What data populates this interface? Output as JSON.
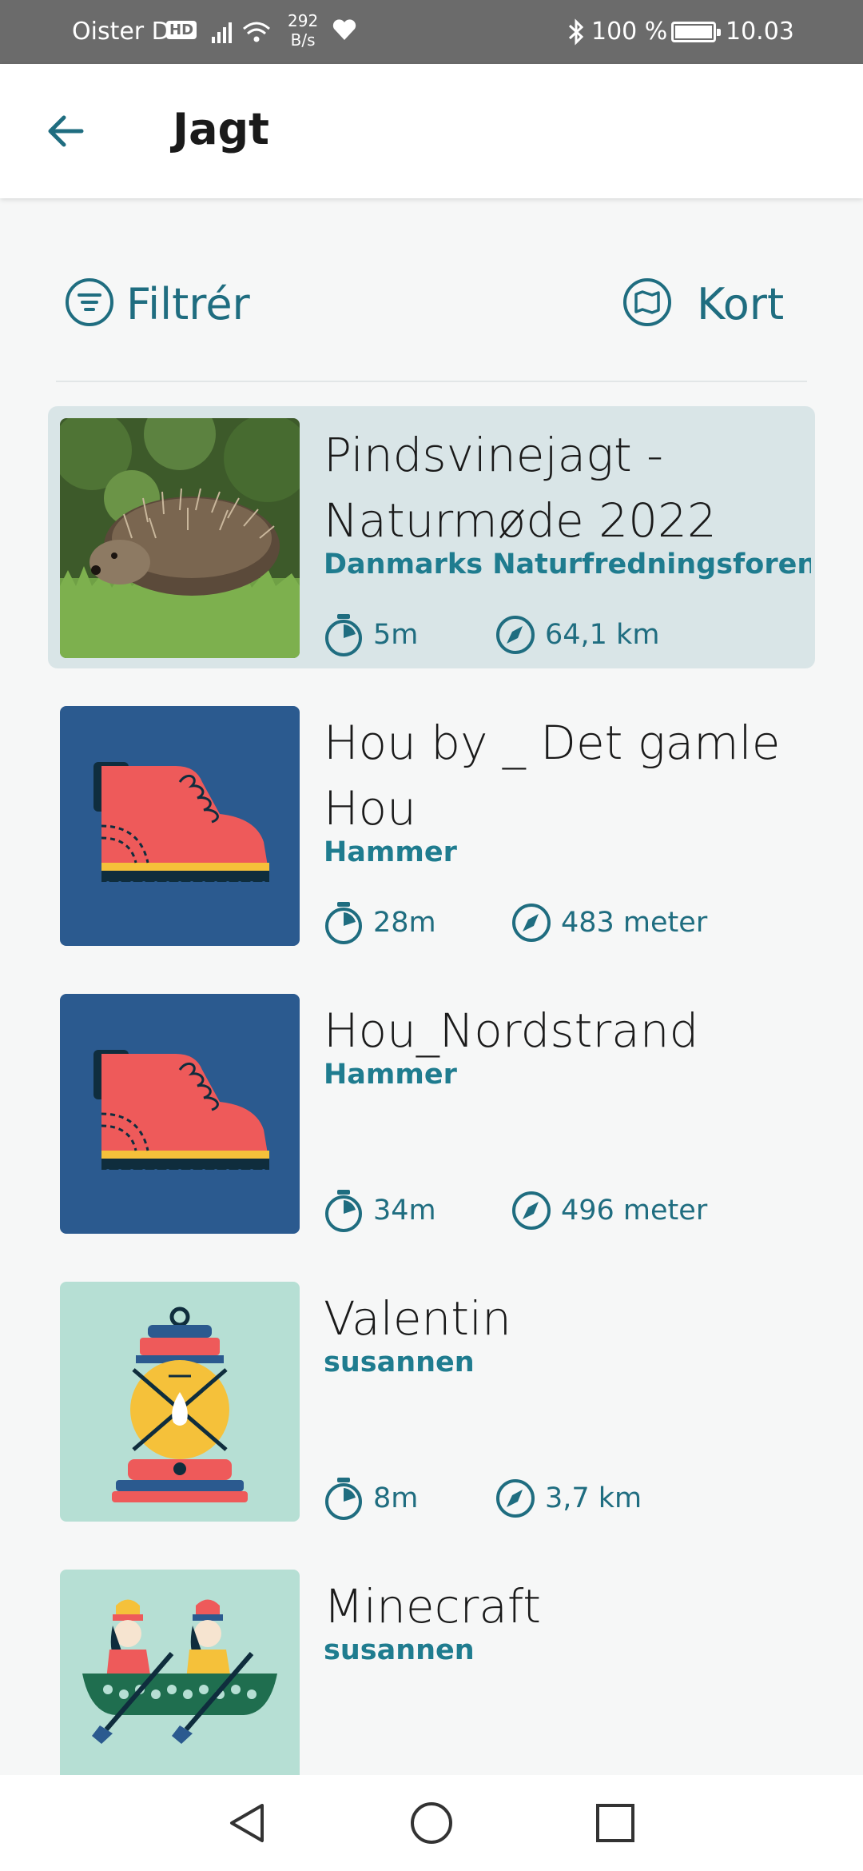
{
  "status_bar": {
    "carrier": "Oister DK",
    "hd": "HD",
    "speed_value": "292",
    "speed_unit": "B/s",
    "battery": "100 %",
    "time": "10.03"
  },
  "app_bar": {
    "title": "Jagt"
  },
  "toolbar": {
    "filter_label": "Filtrér",
    "map_label": "Kort"
  },
  "hunts": [
    {
      "name": "Pindsvinejagt - Naturmøde 2022",
      "author": "Danmarks Naturfredningsforening",
      "duration": "5m",
      "distance": "64,1 km",
      "image": "hedgehog-photo",
      "selected": true
    },
    {
      "name": "Hou by _ Det gamle Hou",
      "author": "Hammer",
      "duration": "28m",
      "distance": "483 meter",
      "image": "boot-icon"
    },
    {
      "name": "Hou_Nordstrand",
      "author": "Hammer",
      "duration": "34m",
      "distance": "496 meter",
      "image": "boot-icon"
    },
    {
      "name": "Valentin",
      "author": "susannen",
      "duration": "8m",
      "distance": "3,7 km",
      "image": "lantern-icon"
    },
    {
      "name": "Minecraft",
      "author": "susannen",
      "duration": "",
      "distance": "",
      "image": "canoe-icon"
    }
  ],
  "colors": {
    "accent": "#1f6d80",
    "author": "#1f7c8f",
    "selected_bg": "#d9e5e7",
    "boot_bg": "#2b5a8f",
    "mint_bg": "#b6dfd4"
  },
  "nav": {
    "back_icon": "triangle-back-icon",
    "home_icon": "circle-home-icon",
    "recent_icon": "square-recents-icon"
  }
}
